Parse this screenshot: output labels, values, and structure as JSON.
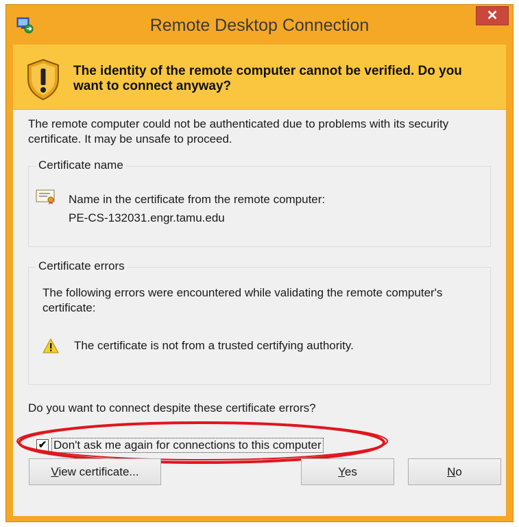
{
  "window": {
    "title": "Remote Desktop Connection",
    "close_glyph": "✕"
  },
  "banner": {
    "text": "The identity of the remote computer cannot be verified. Do you want to connect anyway?"
  },
  "description": "The remote computer could not be authenticated due to problems with its security certificate. It may be unsafe to proceed.",
  "certificate_name": {
    "label": "Certificate name",
    "line1": "Name in the certificate from the remote computer:",
    "line2": "PE-CS-132031.engr.tamu.edu"
  },
  "certificate_errors": {
    "label": "Certificate errors",
    "intro": "The following errors were encountered while validating the remote computer's certificate:",
    "error1": "The certificate is not from a trusted certifying authority."
  },
  "question": "Do you want to connect despite these certificate errors?",
  "dont_ask": {
    "label": "Don't ask me again for connections to this computer",
    "checked": true,
    "check_glyph": "✔"
  },
  "buttons": {
    "view_certificate": {
      "accel": "V",
      "rest": "iew certificate..."
    },
    "yes": {
      "accel": "Y",
      "rest": "es"
    },
    "no": {
      "accel": "N",
      "rest": "o"
    }
  },
  "colors": {
    "title_bar": "#f5a825",
    "banner": "#fac63f",
    "content": "#f0f0f0",
    "close": "#c9483b",
    "annotation_ellipse": "#e0161d"
  },
  "icons": {
    "app": "remote-desktop-icon",
    "close": "close-icon",
    "banner": "warning-shield-icon",
    "certificate": "certificate-icon",
    "error": "warning-triangle-icon"
  }
}
